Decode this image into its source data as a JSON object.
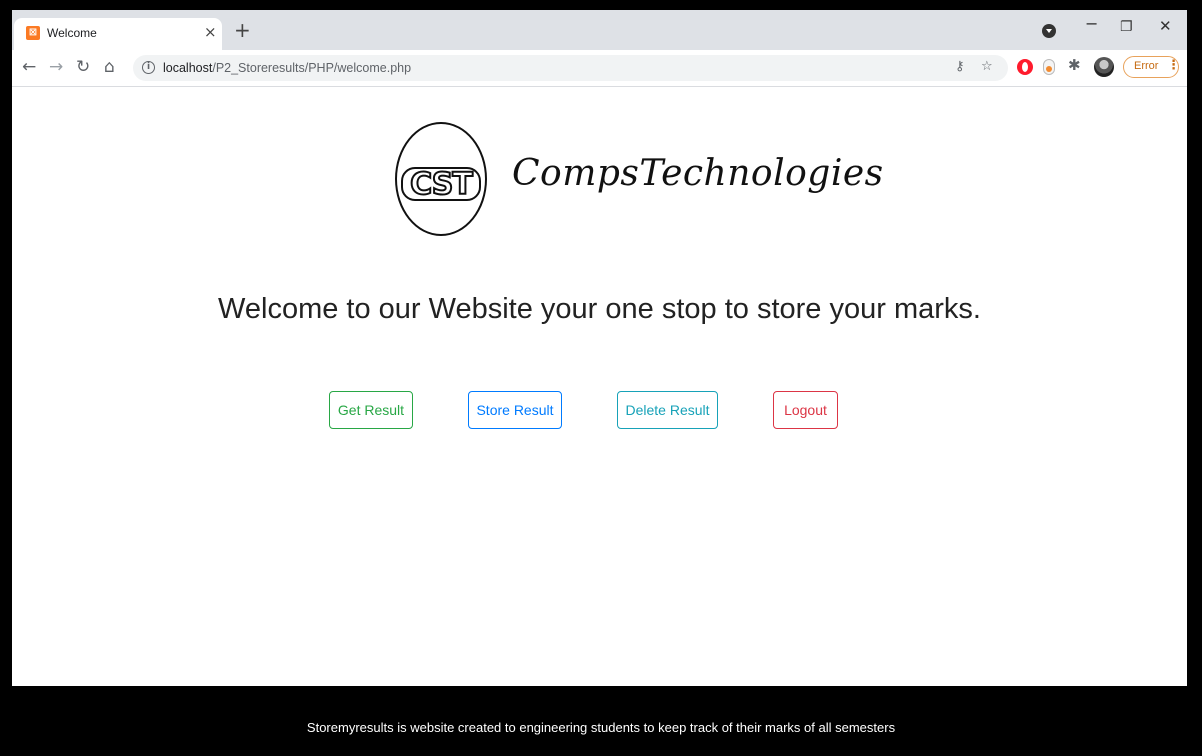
{
  "browser": {
    "tab": {
      "title": "Welcome",
      "favicon": "xampp-favicon-icon",
      "close_glyph": "×"
    },
    "new_tab_glyph": "+",
    "address": {
      "host": "localhost",
      "path": "/P2_Storeresults/PHP/welcome.php"
    },
    "error_label": "Error",
    "menu_glyph": "⋮",
    "colors": {
      "tabstrip": "#dee1e6",
      "error_accent": "#c66b12"
    }
  },
  "page": {
    "logo_text": "CST",
    "brand_name": "CompsTechnologies",
    "welcome_heading": "Welcome to our Website your one stop to store your marks.",
    "buttons": {
      "get_result": "Get Result",
      "store_result": "Store Result",
      "delete_result": "Delete Result",
      "logout": "Logout"
    },
    "button_colors": {
      "get_result": "#28a745",
      "store_result": "#007bff",
      "delete_result": "#17a2b8",
      "logout": "#dc3545"
    }
  },
  "footer": {
    "text": "Storemyresults is website created to engineering students to keep track of their marks of all semesters"
  }
}
